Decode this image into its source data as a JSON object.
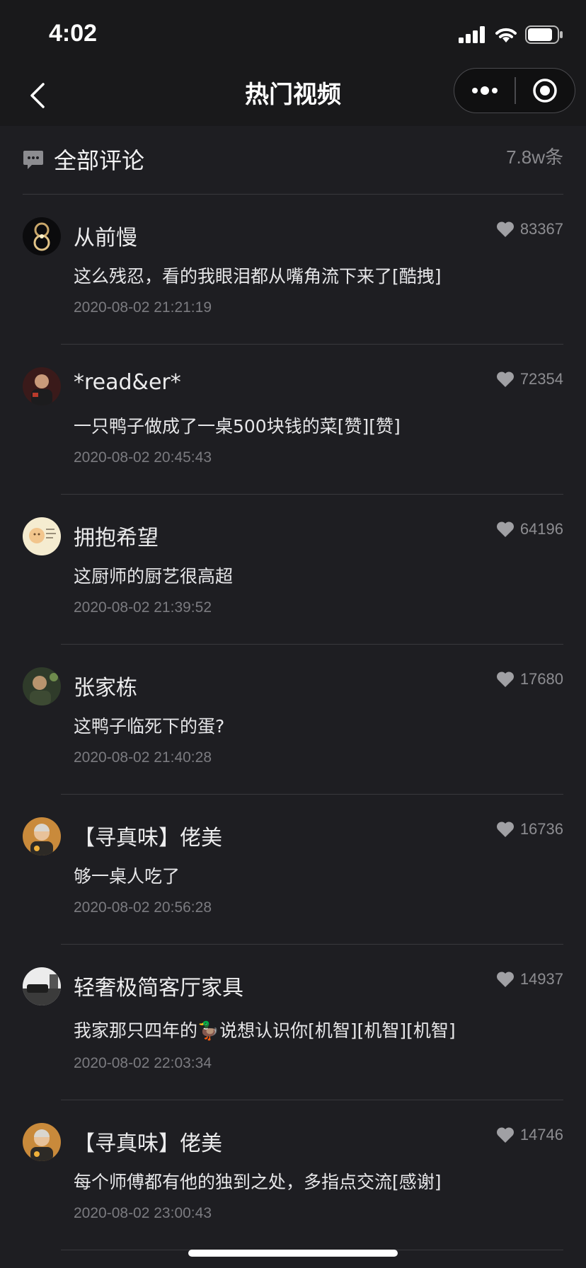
{
  "status": {
    "time": "4:02"
  },
  "nav": {
    "title": "热门视频"
  },
  "section": {
    "title": "全部评论",
    "count": "7.8w条"
  },
  "comments": [
    {
      "name": "从前慢",
      "likes": "83367",
      "text": "这么残忍，看的我眼泪都从嘴角流下来了[酷拽]",
      "time": "2020-08-02 21:21:19"
    },
    {
      "name": "*read&er*",
      "likes": "72354",
      "text": "一只鸭子做成了一桌500块钱的菜[赞][赞]",
      "time": "2020-08-02 20:45:43"
    },
    {
      "name": "拥抱希望",
      "likes": "64196",
      "text": "这厨师的厨艺很高超",
      "time": "2020-08-02 21:39:52"
    },
    {
      "name": "张家栋",
      "likes": "17680",
      "text": "这鸭子临死下的蛋?",
      "time": "2020-08-02 21:40:28"
    },
    {
      "name": "【寻真味】佬美",
      "likes": "16736",
      "text": "够一桌人吃了",
      "time": "2020-08-02 20:56:28"
    },
    {
      "name": "轻奢极简客厅家具",
      "likes": "14937",
      "text": "我家那只四年的🦆说想认识你[机智][机智][机智]",
      "time": "2020-08-02 22:03:34"
    },
    {
      "name": "【寻真味】佬美",
      "likes": "14746",
      "text": "每个师傅都有他的独到之处，多指点交流[感谢]",
      "time": "2020-08-02 23:00:43"
    }
  ],
  "colors": {
    "background": "#1e1e22",
    "header": "#19191b",
    "like": "#a0a0a4"
  }
}
